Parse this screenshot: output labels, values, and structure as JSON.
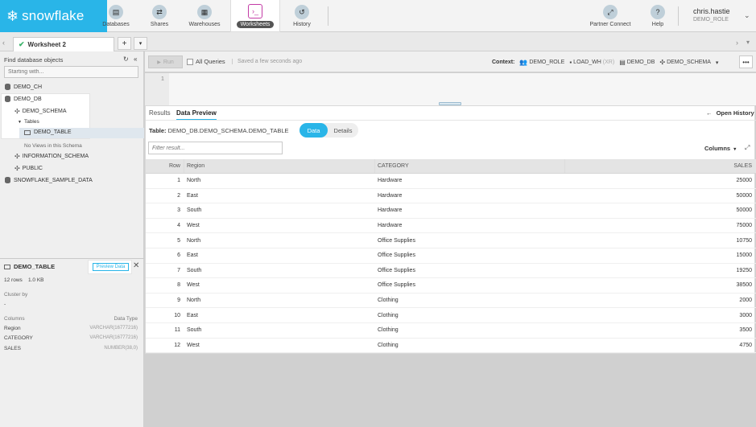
{
  "nav": {
    "brand": "snowflake",
    "items": [
      {
        "label": "Databases",
        "icon": "database-icon"
      },
      {
        "label": "Shares",
        "icon": "shares-icon"
      },
      {
        "label": "Warehouses",
        "icon": "warehouse-icon"
      },
      {
        "label": "Worksheets",
        "icon": "worksheet-icon",
        "active": true
      },
      {
        "label": "History",
        "icon": "history-icon"
      }
    ],
    "partner": "Partner Connect",
    "help": "Help",
    "user_name": "chris.hastie",
    "user_role": "DEMO_ROLE",
    "accent_color": "#29b5e8"
  },
  "worksheet": {
    "tab_name": "Worksheet 2",
    "add_label": "+",
    "run_label": "Run",
    "all_queries": "All Queries",
    "saved": "Saved a few seconds ago",
    "context_label": "Context:",
    "context_role": "DEMO_ROLE",
    "context_wh": "LOAD_WH",
    "context_wh_size": "(XR)",
    "context_db": "DEMO_DB",
    "context_schema": "DEMO_SCHEMA",
    "line_number": "1"
  },
  "sidebar": {
    "header": "Find database objects",
    "search_placeholder": "Starting with...",
    "tree": {
      "demo_ch": "DEMO_CH",
      "demo_db": "DEMO_DB",
      "demo_schema": "DEMO_SCHEMA",
      "tables": "Tables",
      "demo_table": "DEMO_TABLE",
      "no_views": "No Views in this Schema",
      "information_schema": "INFORMATION_SCHEMA",
      "public": "PUBLIC",
      "sample_data": "SNOWFLAKE_SAMPLE_DATA"
    },
    "details": {
      "table_name": "DEMO_TABLE",
      "preview_button": "Preview Data",
      "rows": "12 rows",
      "size": "1.0 KB",
      "cluster_by_label": "Cluster by",
      "cluster_by_value": "-",
      "columns_label": "Columns",
      "data_type_label": "Data Type",
      "columns": [
        {
          "name": "Region",
          "type": "VARCHAR(16777216)"
        },
        {
          "name": "CATEGORY",
          "type": "VARCHAR(16777216)"
        },
        {
          "name": "SALES",
          "type": "NUMBER(38,0)"
        }
      ]
    }
  },
  "results": {
    "tab_results": "Results",
    "tab_preview": "Data Preview",
    "open_history": "Open History",
    "table_label": "Table:",
    "table_path": "DEMO_DB.DEMO_SCHEMA.DEMO_TABLE",
    "toggle_data": "Data",
    "toggle_details": "Details",
    "filter_placeholder": "Filter result...",
    "columns_button": "Columns",
    "headers": {
      "row": "Row",
      "region": "Region",
      "category": "CATEGORY",
      "sales": "SALES"
    },
    "rows": [
      {
        "row": "1",
        "region": "North",
        "category": "Hardware",
        "sales": "25000"
      },
      {
        "row": "2",
        "region": "East",
        "category": "Hardware",
        "sales": "50000"
      },
      {
        "row": "3",
        "region": "South",
        "category": "Hardware",
        "sales": "50000"
      },
      {
        "row": "4",
        "region": "West",
        "category": "Hardware",
        "sales": "75000"
      },
      {
        "row": "5",
        "region": "North",
        "category": "Office Supplies",
        "sales": "10750"
      },
      {
        "row": "6",
        "region": "East",
        "category": "Office Supplies",
        "sales": "15000"
      },
      {
        "row": "7",
        "region": "South",
        "category": "Office Supplies",
        "sales": "19250"
      },
      {
        "row": "8",
        "region": "West",
        "category": "Office Supplies",
        "sales": "38500"
      },
      {
        "row": "9",
        "region": "North",
        "category": "Clothing",
        "sales": "2000"
      },
      {
        "row": "10",
        "region": "East",
        "category": "Clothing",
        "sales": "3000"
      },
      {
        "row": "11",
        "region": "South",
        "category": "Clothing",
        "sales": "3500"
      },
      {
        "row": "12",
        "region": "West",
        "category": "Clothing",
        "sales": "4750"
      }
    ]
  }
}
